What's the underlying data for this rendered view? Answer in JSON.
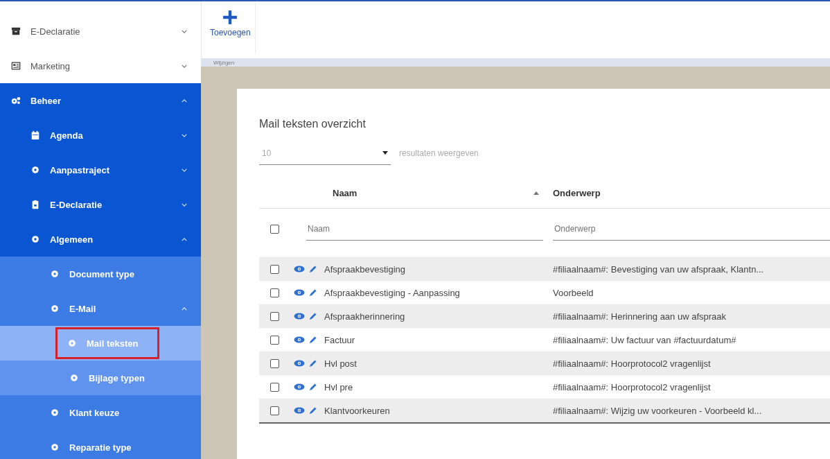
{
  "sidebar": {
    "items": [
      {
        "label": "E-Declaratie",
        "expanded": false
      },
      {
        "label": "Marketing",
        "expanded": false
      },
      {
        "label": "Beheer",
        "expanded": true,
        "children": [
          {
            "label": "Agenda",
            "expanded": false
          },
          {
            "label": "Aanpastraject",
            "expanded": false
          },
          {
            "label": "E-Declaratie",
            "expanded": false
          },
          {
            "label": "Algemeen",
            "expanded": true,
            "children": [
              {
                "label": "Document type"
              },
              {
                "label": "E-Mail",
                "expanded": true,
                "children": [
                  {
                    "label": "Mail teksten",
                    "selected": true,
                    "highlighted": true
                  },
                  {
                    "label": "Bijlage typen",
                    "selected": false,
                    "highlighted": false
                  }
                ]
              },
              {
                "label": "Klant keuze"
              },
              {
                "label": "Reparatie type"
              }
            ]
          }
        ]
      }
    ]
  },
  "toolbar": {
    "buttons": [
      {
        "label": "Toevoegen"
      }
    ],
    "group_label": "Wijzigen"
  },
  "card": {
    "title": "Mail teksten overzicht",
    "page_size": {
      "value": "10",
      "suffix": "resultaten weergeven"
    },
    "table": {
      "select_all_checked": false,
      "columns": [
        {
          "label": "Naam",
          "sorted": true,
          "filter_placeholder": "Naam"
        },
        {
          "label": "Onderwerp",
          "sorted": false,
          "filter_placeholder": "Onderwerp"
        }
      ],
      "rows": [
        {
          "naam": "Afspraakbevestiging",
          "onderwerp": "#filiaalnaam#: Bevestiging van uw afspraak, Klantn...",
          "checked": false
        },
        {
          "naam": "Afspraakbevestiging - Aanpassing",
          "onderwerp": "Voorbeeld",
          "checked": false
        },
        {
          "naam": "Afspraakherinnering",
          "onderwerp": "#filiaalnaam#: Herinnering aan uw afspraak",
          "checked": false
        },
        {
          "naam": "Factuur",
          "onderwerp": "#filiaalnaam#: Uw factuur van #factuurdatum#",
          "checked": false
        },
        {
          "naam": "Hvl post",
          "onderwerp": "#filiaalnaam#: Hoorprotocol2 vragenlijst",
          "checked": false
        },
        {
          "naam": "Hvl pre",
          "onderwerp": "#filiaalnaam#: Hoorprotocol2 vragenlijst",
          "checked": false
        },
        {
          "naam": "Klantvoorkeuren",
          "onderwerp": "#filiaalnaam#: Wijzig uw voorkeuren - Voorbeeld kl...",
          "checked": false
        }
      ]
    }
  }
}
